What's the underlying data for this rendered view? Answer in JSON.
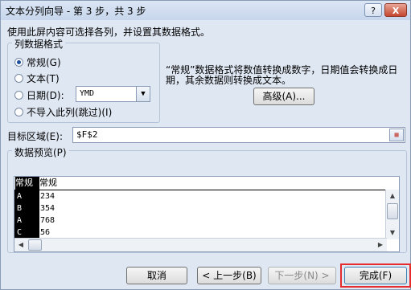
{
  "window": {
    "title": "文本分列向导 - 第 3 步，共 3 步",
    "help_glyph": "?",
    "close_glyph": "X"
  },
  "description": "使用此屏内容可选择各列，并设置其数据格式。",
  "column_format": {
    "group_label": "列数据格式",
    "options": [
      {
        "label": "常规(G)",
        "selected": true
      },
      {
        "label": "文本(T)",
        "selected": false
      },
      {
        "label": "日期(D):",
        "selected": false
      },
      {
        "label": "不导入此列(跳过)(I)",
        "selected": false
      }
    ],
    "date_select_value": "YMD",
    "hint": "“常规”数据格式将数值转换成数字，日期值会转换成日期，其余数据则转换成文本。",
    "advanced_button": "高级(A)..."
  },
  "destination": {
    "label": "目标区域(E):",
    "value": "$F$2"
  },
  "preview": {
    "label": "数据预览(P)",
    "columns": [
      "常规",
      "常规"
    ],
    "rows": [
      [
        "A",
        "234"
      ],
      [
        "B",
        "354"
      ],
      [
        "A",
        "768"
      ],
      [
        "C",
        "56"
      ]
    ]
  },
  "buttons": {
    "cancel": "取消",
    "back": "< 上一步(B)",
    "next": "下一步(N) >",
    "finish": "完成(F)"
  },
  "colors": {
    "highlight_border": "#e52b2b",
    "window_bg": "#dfe7f3"
  }
}
